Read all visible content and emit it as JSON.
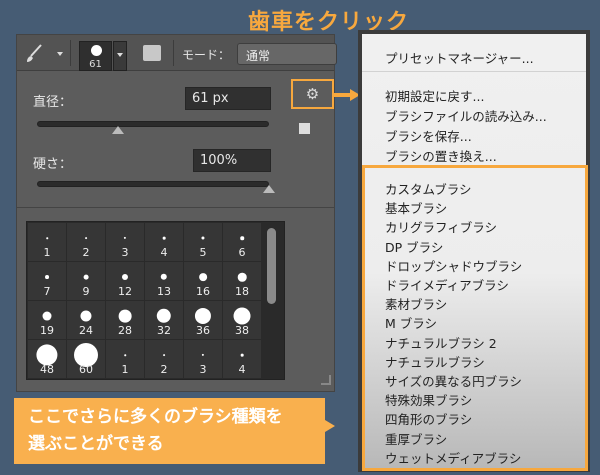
{
  "annotations": {
    "title": "歯車をクリック",
    "callout_line1": "ここでさらに多くのブラシ種類を",
    "callout_line2": "選ぶことができる",
    "accent": "#f7a83e"
  },
  "toolbar": {
    "brush_size": "61",
    "mode_label": "モード：",
    "mode_value": "通常"
  },
  "panel": {
    "diameter_label": "直径：",
    "diameter_value": "61 px",
    "diameter_slider": 0.35,
    "hardness_label": "硬さ：",
    "hardness_value": "100%",
    "hardness_slider": 1.0
  },
  "brushes": [
    1,
    2,
    3,
    4,
    5,
    6,
    7,
    9,
    12,
    13,
    16,
    18,
    19,
    24,
    28,
    32,
    36,
    38,
    48,
    60,
    1,
    2,
    3,
    4
  ],
  "menu": {
    "top": [
      "プリセットマネージャー..."
    ],
    "actions": [
      "初期設定に戻す...",
      "ブラシファイルの読み込み...",
      "ブラシを保存...",
      "ブラシの置き換え..."
    ],
    "libraries": [
      "カスタムブラシ",
      "基本ブラシ",
      "カリグラフィブラシ",
      "DP ブラシ",
      "ドロップシャドウブラシ",
      "ドライメディアブラシ",
      "素材ブラシ",
      "M ブラシ",
      "ナチュラルブラシ 2",
      "ナチュラルブラシ",
      "サイズの異なる円ブラシ",
      "特殊効果ブラシ",
      "四角形のブラシ",
      "重厚ブラシ",
      "ウェットメディアブラシ"
    ]
  }
}
